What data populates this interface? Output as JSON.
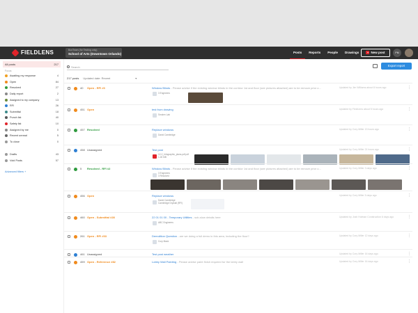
{
  "app": {
    "logo": "FIELDLENS",
    "project_line1": "BoxTeam (for Testing only)",
    "project_line2": "School of Arts (Downtown Orlando)",
    "nav": [
      "Posts",
      "Reports",
      "People",
      "Drawings"
    ],
    "new_post": "New post",
    "user_initials": "PM",
    "plus": "+"
  },
  "sidebar": {
    "all_posts": {
      "label": "All posts",
      "count": "217"
    },
    "section_label": "Focus",
    "items": [
      {
        "label": "Awaiting my response",
        "count": "4",
        "color": "#f0a020"
      },
      {
        "label": "Open",
        "count": "84",
        "color": "#f08a1c"
      },
      {
        "label": "Resolved",
        "count": "27",
        "color": "#2e9a3e"
      },
      {
        "label": "Daily report",
        "count": "2",
        "color": "#888888"
      },
      {
        "label": "Assigned to my company",
        "count": "13",
        "color": "#6a8a3a"
      },
      {
        "label": "RFI",
        "count": "26",
        "color": "#2d7fd3"
      },
      {
        "label": "Submittal",
        "count": "18",
        "color": "#3a8a8a"
      },
      {
        "label": "Punch list",
        "count": "40",
        "color": "#555555"
      },
      {
        "label": "Safety list",
        "count": "10",
        "color": "#e0232a"
      },
      {
        "label": "Assigned by me",
        "count": "0",
        "color": "#888888"
      },
      {
        "label": "Recent unread",
        "count": "5",
        "color": "#666666"
      },
      {
        "label": "To close",
        "count": "0",
        "color": "#999999"
      }
    ],
    "extra_items": [
      {
        "label": "Drafts",
        "count": "43",
        "color": "#999999"
      },
      {
        "label": "Void Posts",
        "count": "57",
        "color": "#999999"
      }
    ],
    "advanced_filters": "Advanced filters +"
  },
  "toolbar": {
    "search_placeholder": "Search",
    "export": "Export report",
    "post_count": "217 posts",
    "sort": "Updated date: Recent",
    "sort_caret": "▾"
  },
  "posts": [
    {
      "num": "40",
      "status": "Open - RFI #3",
      "title": "Window Blinds",
      "desc": "- Please advise if the existing window blinds in the corridor 1st and floor (see pictures attached) are to be remove prior o...",
      "meta": "Updated by Jim Williams about 8 hours ago",
      "attachment": "3 Engineers"
    },
    {
      "num": "451",
      "status": "Open",
      "title": "test from drawing",
      "desc": "",
      "meta": "Updated by FieldLens about 5 hours ago",
      "attachment": "Smolen Lab"
    },
    {
      "num": "457",
      "status": "Resolved",
      "title": "Replace windows",
      "desc": "",
      "meta": "Updated by Cory Miller 13 hours ago",
      "attachment": "David Cambridge"
    },
    {
      "num": "458",
      "status": "Unassigned",
      "title": "Test post",
      "desc": "",
      "meta": "Updated by Cory Miller 21 hours ago",
      "attachment": "12-2_Infographic_plans.pdf pdf",
      "attachment2": "1.26 MB"
    },
    {
      "num": "5",
      "status": "Resolved - RFI #2",
      "title": "Window Blinds",
      "desc": "- Please advise if the existing window blinds in the corridor 1st and floor (see pictures attached) are to be remove prior o...",
      "meta": "Updated by Cory Miller 3 days ago",
      "attachment": "3 Engineers",
      "attachment2": "3 Resolved"
    },
    {
      "num": "456",
      "status": "Open",
      "title": "Replace windows",
      "desc": "",
      "meta": "Updated by Cory Miller 5 days ago",
      "attachment": "David Cambridge",
      "attachment2": "Cambridge Drywall (RFI)"
    },
    {
      "num": "460",
      "status": "Open - Submittal #28",
      "title": "22 01 01 00 - Temporary Utilities",
      "desc": "- sub-slow details here",
      "meta": "Updated by Josh Holman Construction 6 days ago",
      "attachment": "ABC Engineers"
    },
    {
      "num": "261",
      "status": "Open - RFI #33",
      "title": "Demolition Question",
      "desc": "- are we doing a full demo in this area, including the floor?",
      "meta": "Updated by Cory Miller 12 days ago",
      "attachment": "Cory Mack"
    },
    {
      "num": "461",
      "status": "Unassigned",
      "title": "Test post weather",
      "desc": "",
      "meta": "Updated by Cory Miller 16 days ago",
      "attachment": ""
    },
    {
      "num": "459",
      "status": "Open - Reference #82",
      "title": "Lobby Wall Painting",
      "desc": "- Please advise paint finish required for the lobby wall",
      "meta": "Updated by Cory Miller 16 days ago",
      "attachment": ""
    }
  ],
  "colors": {
    "accent": "#e0232a",
    "open": "#f08a1c",
    "resolved": "#2e9a3e",
    "link": "#2d7fd3",
    "topbar": "#2f2f2f"
  },
  "icons": [
    "search-icon",
    "print-icon",
    "more-icon",
    "status-icon",
    "pdf-icon"
  ]
}
